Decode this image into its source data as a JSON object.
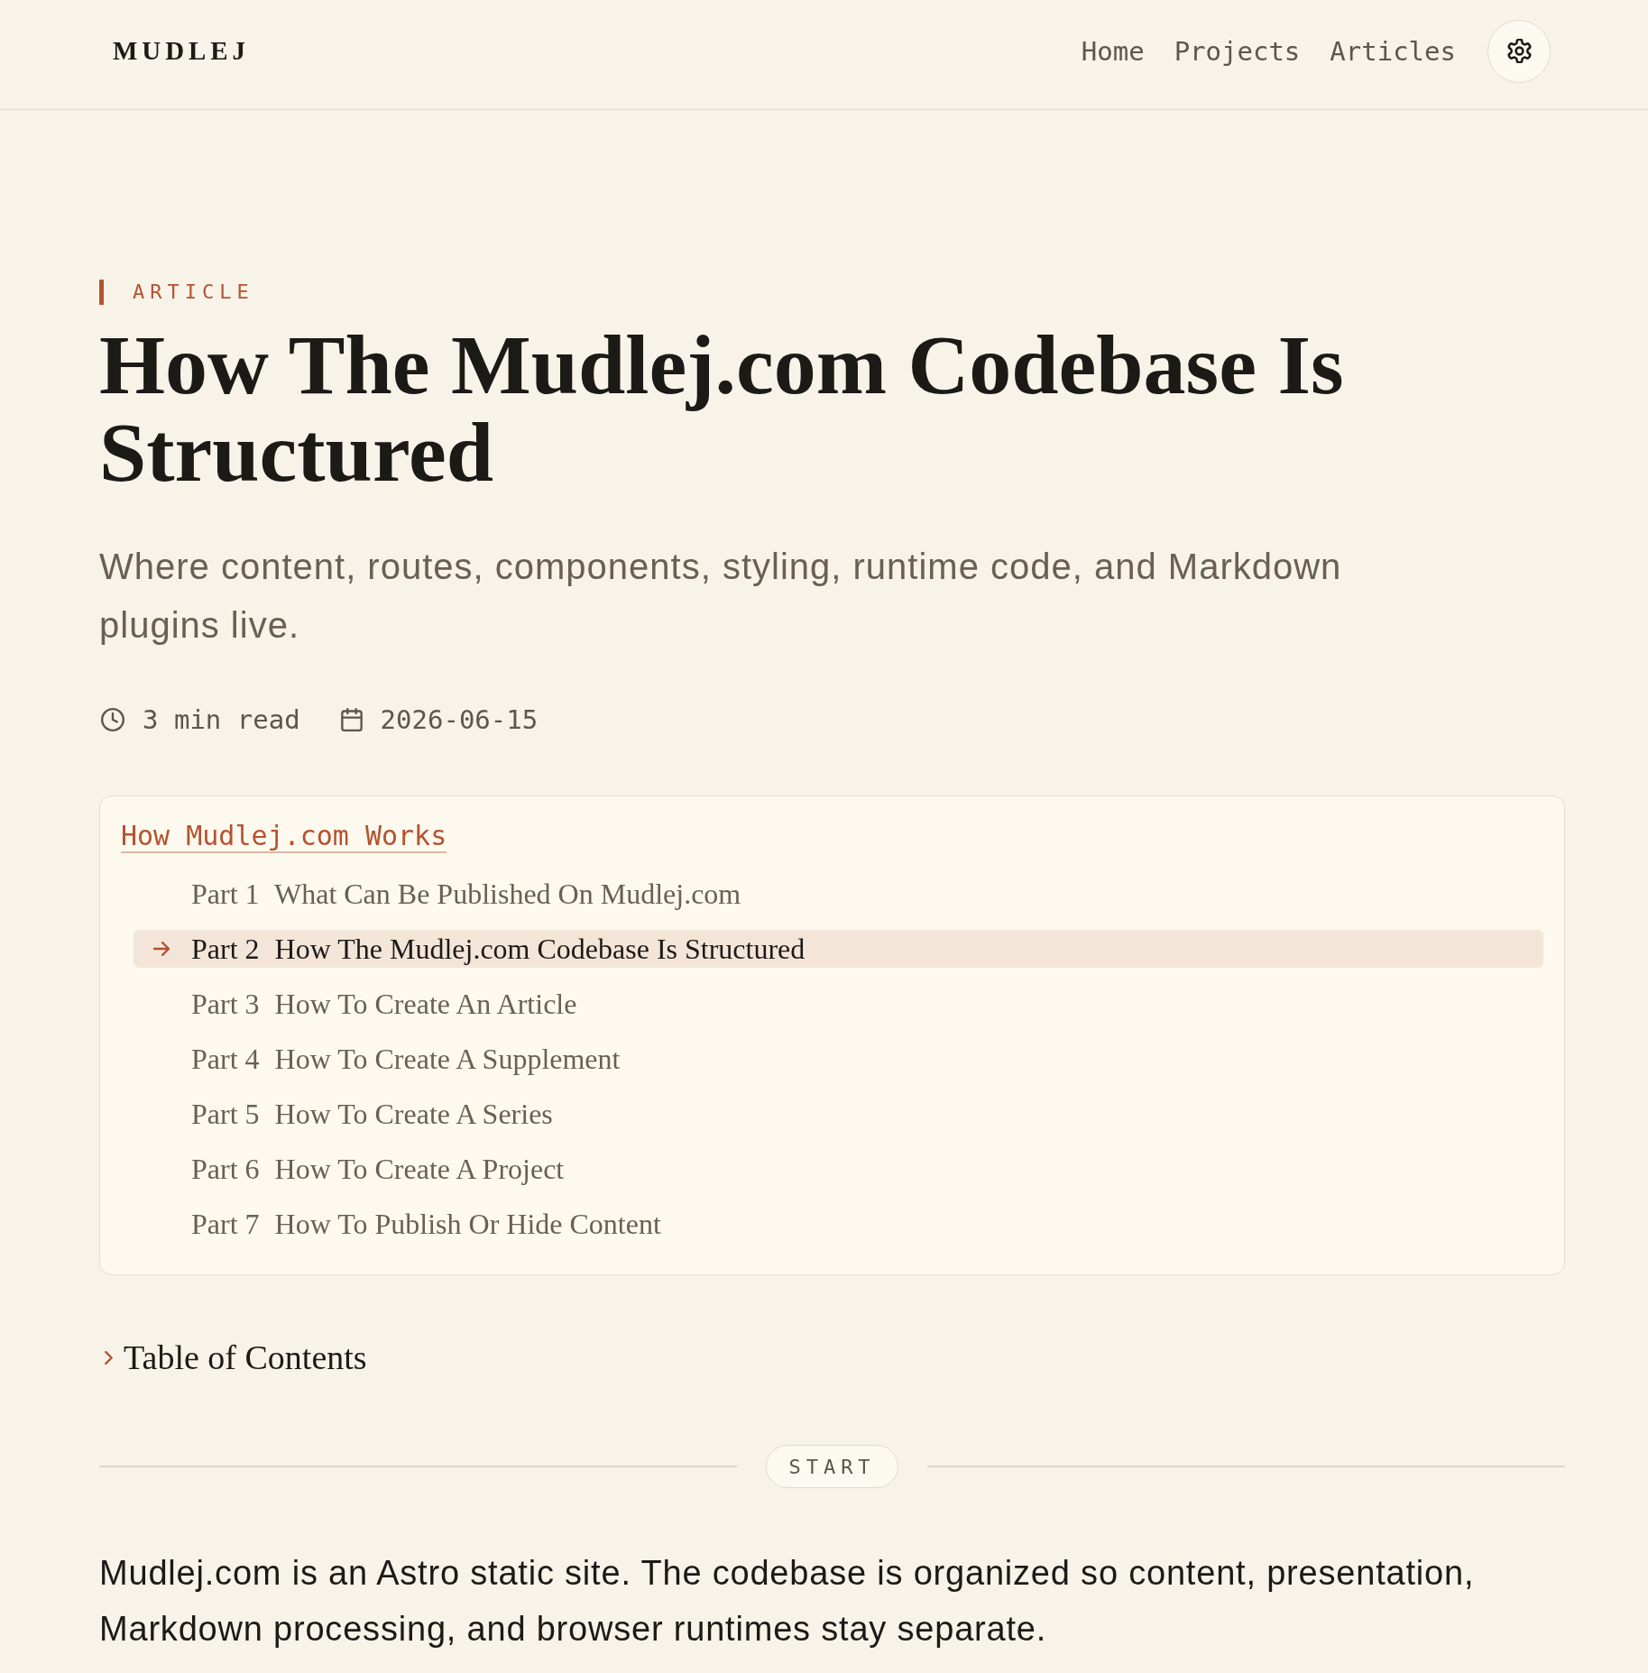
{
  "header": {
    "logo": "MUDLEJ",
    "nav": [
      {
        "label": "Home"
      },
      {
        "label": "Projects"
      },
      {
        "label": "Articles"
      }
    ]
  },
  "article": {
    "eyebrow": "ARTICLE",
    "title": "How The Mudlej.com Codebase Is Structured",
    "subtitle": "Where content, routes, components, styling, runtime code, and Markdown plugins live.",
    "meta": [
      {
        "kind": "duration",
        "text": "3 min read"
      },
      {
        "kind": "date",
        "text": "2026-06-15"
      }
    ]
  },
  "series": {
    "title": "How Mudlej.com Works",
    "parts": [
      {
        "part": "Part 1",
        "title": "What Can Be Published On Mudlej.com",
        "selected": false
      },
      {
        "part": "Part 2",
        "title": "How The Mudlej.com Codebase Is Structured",
        "selected": true
      },
      {
        "part": "Part 3",
        "title": "How To Create An Article",
        "selected": false
      },
      {
        "part": "Part 4",
        "title": "How To Create A Supplement",
        "selected": false
      },
      {
        "part": "Part 5",
        "title": "How To Create A Series",
        "selected": false
      },
      {
        "part": "Part 6",
        "title": "How To Create A Project",
        "selected": false
      },
      {
        "part": "Part 7",
        "title": "How To Publish Or Hide Content",
        "selected": false
      }
    ]
  },
  "table_of_contents": {
    "label": "Table of Contents",
    "expanded": false
  },
  "divider": {
    "label": "START"
  },
  "body": {
    "paragraphs": [
      "Mudlej.com is an Astro static site. The codebase is organized so content, presentation, Markdown processing, and browser runtimes stay separate."
    ]
  }
}
